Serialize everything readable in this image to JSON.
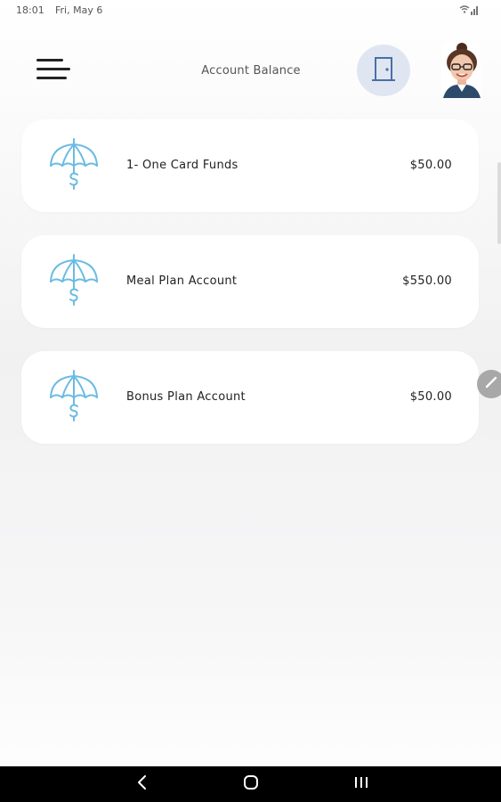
{
  "status_bar": {
    "time": "18:01",
    "date": "Fri, May 6",
    "icons": [
      "wifi-icon",
      "signal-icon"
    ]
  },
  "header": {
    "title": "Account Balance",
    "menu_icon": "menu-icon",
    "door_icon": "door-icon",
    "avatar": "avatar"
  },
  "accounts": [
    {
      "name": "1- One Card Funds",
      "amount": "$50.00",
      "icon": "umbrella-dollar-icon"
    },
    {
      "name": "Meal Plan Account",
      "amount": "$550.00",
      "icon": "umbrella-dollar-icon"
    },
    {
      "name": "Bonus Plan Account",
      "amount": "$50.00",
      "icon": "umbrella-dollar-icon"
    }
  ],
  "colors": {
    "accent": "#6bbbe3",
    "door_bg": "#dfe6f2",
    "door_icon": "#4a6fa5",
    "fab": "#a8a8a8",
    "nav_bar": "#000000"
  }
}
